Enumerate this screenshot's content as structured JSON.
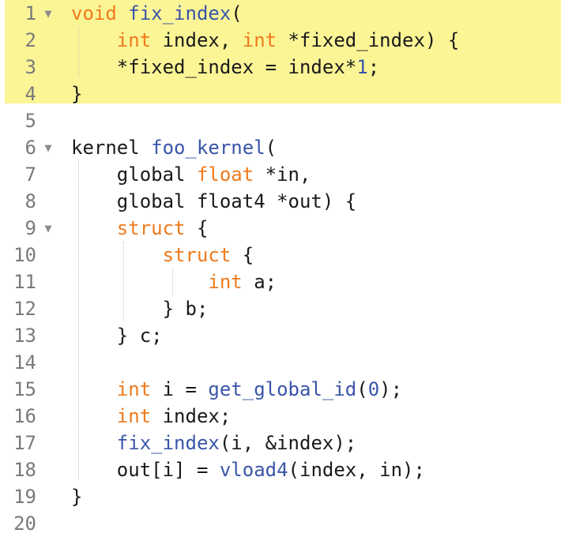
{
  "editor": {
    "lines": [
      {
        "number": "1",
        "fold": "▼",
        "tokens": [
          {
            "t": "void",
            "c": "kw"
          },
          {
            "t": " "
          },
          {
            "t": "fix_index",
            "c": "fn"
          },
          {
            "t": "("
          }
        ]
      },
      {
        "number": "2",
        "fold": "",
        "tokens": [
          {
            "t": "    "
          },
          {
            "t": "int",
            "c": "kw"
          },
          {
            "t": " index, "
          },
          {
            "t": "int",
            "c": "kw"
          },
          {
            "t": " *fixed_index) {"
          }
        ]
      },
      {
        "number": "3",
        "fold": "",
        "tokens": [
          {
            "t": "    *fixed_index = index*"
          },
          {
            "t": "1",
            "c": "num"
          },
          {
            "t": ";"
          }
        ]
      },
      {
        "number": "4",
        "fold": "",
        "tokens": [
          {
            "t": "}"
          }
        ]
      },
      {
        "number": "5",
        "fold": "",
        "tokens": []
      },
      {
        "number": "6",
        "fold": "▼",
        "tokens": [
          {
            "t": "kernel "
          },
          {
            "t": "foo_kernel",
            "c": "fn"
          },
          {
            "t": "("
          }
        ]
      },
      {
        "number": "7",
        "fold": "",
        "tokens": [
          {
            "t": "    global "
          },
          {
            "t": "float",
            "c": "kw"
          },
          {
            "t": " *in,"
          }
        ]
      },
      {
        "number": "8",
        "fold": "",
        "tokens": [
          {
            "t": "    global float4 *out) {"
          }
        ]
      },
      {
        "number": "9",
        "fold": "▼",
        "tokens": [
          {
            "t": "    "
          },
          {
            "t": "struct",
            "c": "kw"
          },
          {
            "t": " {"
          }
        ]
      },
      {
        "number": "10",
        "fold": "",
        "tokens": [
          {
            "t": "        "
          },
          {
            "t": "struct",
            "c": "kw"
          },
          {
            "t": " {"
          }
        ]
      },
      {
        "number": "11",
        "fold": "",
        "tokens": [
          {
            "t": "            "
          },
          {
            "t": "int",
            "c": "kw"
          },
          {
            "t": " a;"
          }
        ]
      },
      {
        "number": "12",
        "fold": "",
        "tokens": [
          {
            "t": "        } b;"
          }
        ]
      },
      {
        "number": "13",
        "fold": "",
        "tokens": [
          {
            "t": "    } c;"
          }
        ]
      },
      {
        "number": "14",
        "fold": "",
        "tokens": []
      },
      {
        "number": "15",
        "fold": "",
        "tokens": [
          {
            "t": "    "
          },
          {
            "t": "int",
            "c": "kw"
          },
          {
            "t": " i = "
          },
          {
            "t": "get_global_id",
            "c": "fn"
          },
          {
            "t": "("
          },
          {
            "t": "0",
            "c": "num"
          },
          {
            "t": ");"
          }
        ]
      },
      {
        "number": "16",
        "fold": "",
        "tokens": [
          {
            "t": "    "
          },
          {
            "t": "int",
            "c": "kw"
          },
          {
            "t": " index;"
          }
        ]
      },
      {
        "number": "17",
        "fold": "",
        "tokens": [
          {
            "t": "    "
          },
          {
            "t": "fix_index",
            "c": "fn"
          },
          {
            "t": "(i, &index);"
          }
        ]
      },
      {
        "number": "18",
        "fold": "",
        "tokens": [
          {
            "t": "    out[i] = "
          },
          {
            "t": "vload4",
            "c": "fn"
          },
          {
            "t": "(index, in);"
          }
        ]
      },
      {
        "number": "19",
        "fold": "",
        "tokens": [
          {
            "t": "}"
          }
        ]
      },
      {
        "number": "20",
        "fold": "",
        "tokens": []
      }
    ],
    "highlight_color": "#fbf596",
    "keyword_color": "#ee7a1c",
    "function_color": "#3a55a8",
    "line_number_color": "#7a7a7a"
  }
}
